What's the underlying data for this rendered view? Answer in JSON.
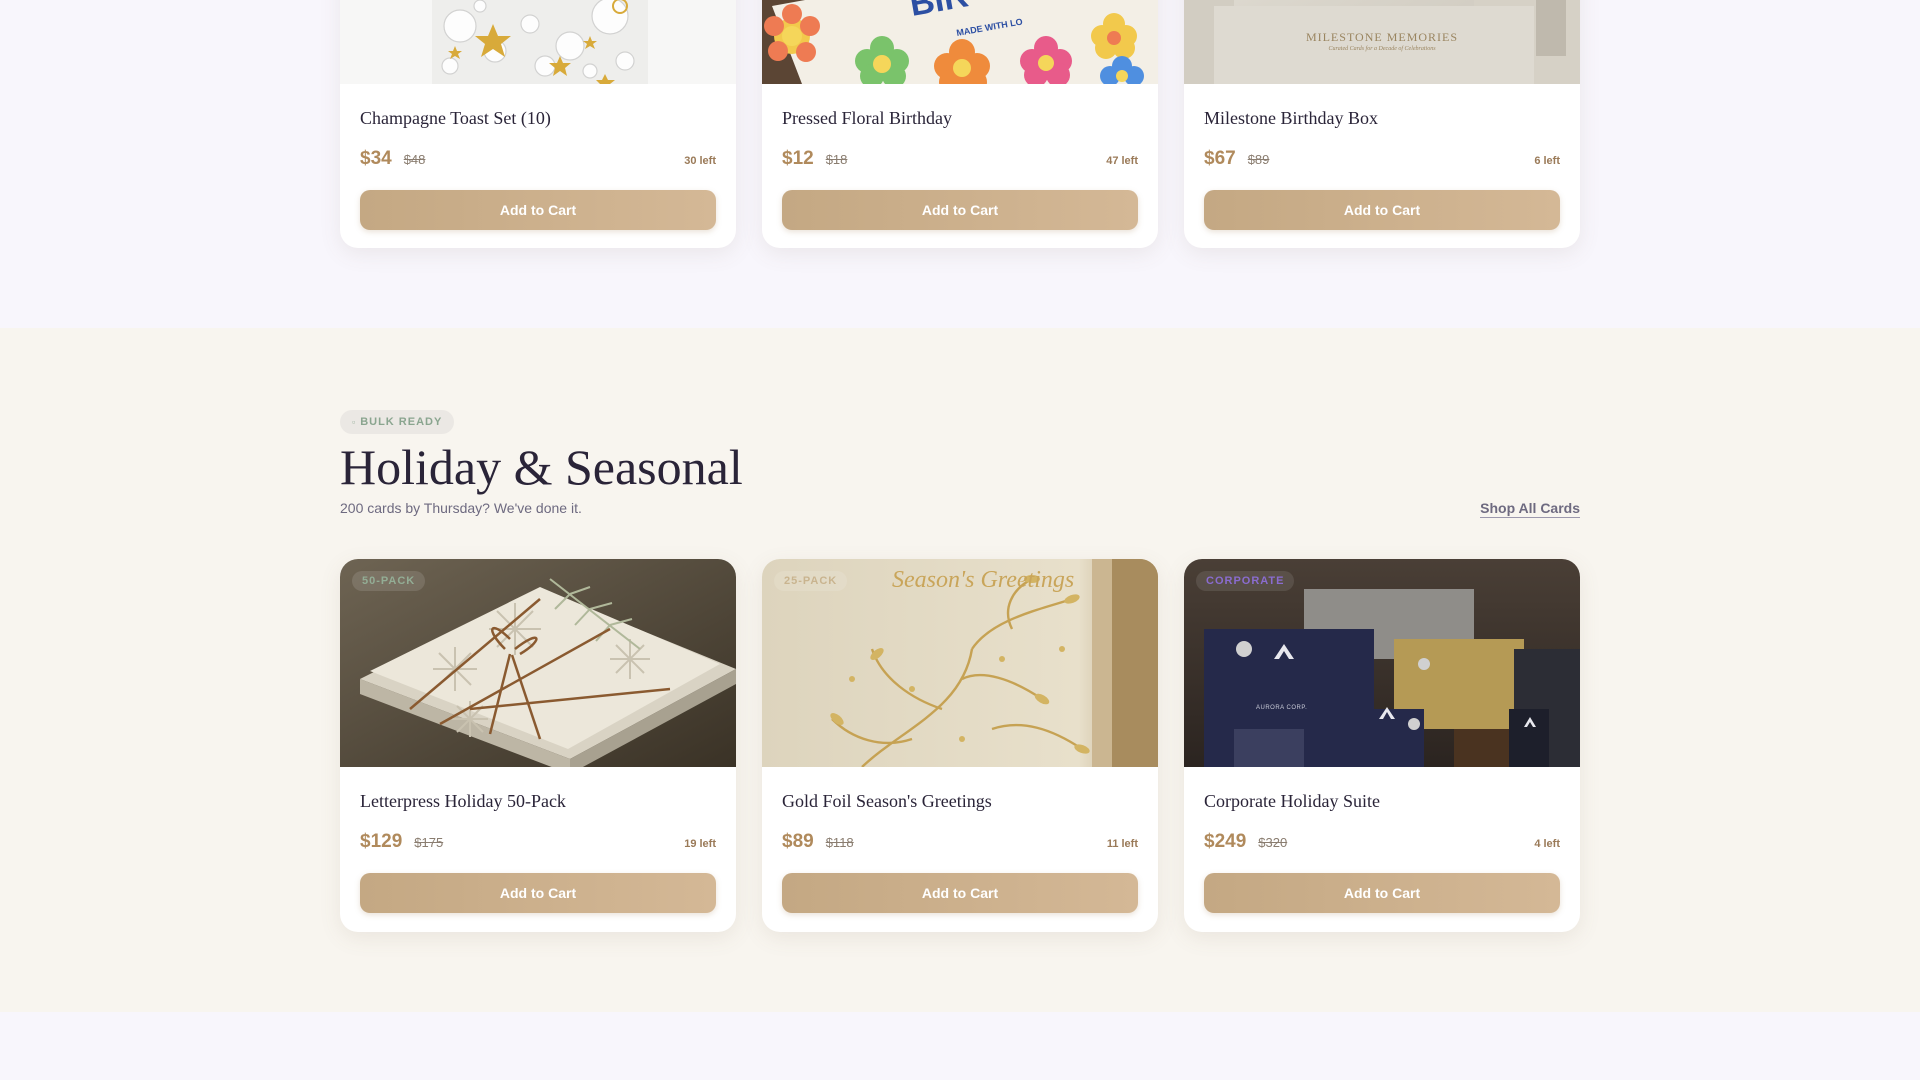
{
  "top_products": [
    {
      "name": "Champagne Toast Set (10)",
      "price": "$34",
      "old_price": "$48",
      "stock": "30 left",
      "button": "Add to Cart",
      "image": "champagne-bubbles-stars-card"
    },
    {
      "name": "Pressed Floral Birthday",
      "price": "$12",
      "old_price": "$18",
      "stock": "47 left",
      "button": "Add to Cart",
      "image": "crayon-flowers-birthday-card",
      "image_text": "MADE WITH LO"
    },
    {
      "name": "Milestone Birthday Box",
      "price": "$67",
      "old_price": "$89",
      "stock": "6 left",
      "button": "Add to Cart",
      "image": "milestone-memories-box",
      "image_text": "MILESTONE MEMORIES",
      "image_subtext": "Curated Cards for a Decade of Celebrations"
    }
  ],
  "holiday": {
    "badge_icon": "square-icon",
    "badge": "BULK READY",
    "title": "Holiday & Seasonal",
    "subtitle": "200 cards by Thursday? We've done it.",
    "shop_all": "Shop All Cards",
    "products": [
      {
        "tag": "50-PACK",
        "name": "Letterpress Holiday 50-Pack",
        "price": "$129",
        "old_price": "$175",
        "stock": "19 left",
        "button": "Add to Cart",
        "image": "letterpress-snowflake-cards-twine"
      },
      {
        "tag": "25-PACK",
        "name": "Gold Foil Season's Greetings",
        "price": "$89",
        "old_price": "$118",
        "stock": "11 left",
        "button": "Add to Cart",
        "image": "gold-foil-vine-card",
        "image_text": "Season's Greetings"
      },
      {
        "tag": "CORPORATE",
        "name": "Corporate Holiday Suite",
        "price": "$249",
        "old_price": "$320",
        "stock": "4 left",
        "button": "Add to Cart",
        "image": "corporate-gift-boxes",
        "image_text": "AURORA CORP."
      }
    ]
  },
  "colors": {
    "accent": "#c4a883",
    "price": "#b08a5c",
    "background_light": "#f8f6fc",
    "background_warm": "#f8f5ef"
  }
}
